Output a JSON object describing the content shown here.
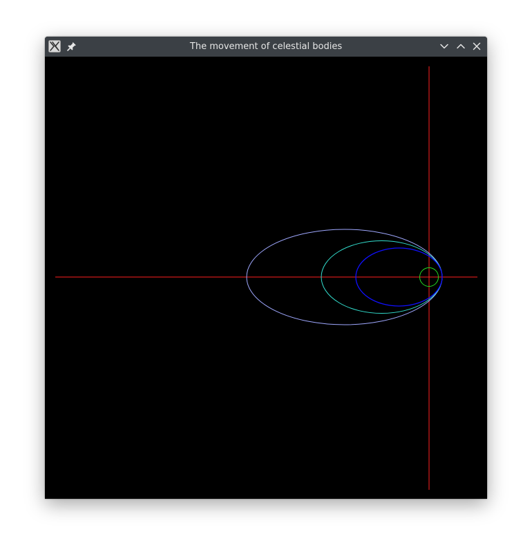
{
  "window": {
    "title": "The movement of celestial bodies"
  },
  "icons": {
    "app": "x11-app-icon",
    "pin": "pin-icon",
    "minimize": "chevron-down-icon",
    "maximize": "chevron-up-icon",
    "close": "close-icon"
  },
  "colors": {
    "titlebar": "#3b4045",
    "canvas_background": "#000000",
    "axes": "#ff2020",
    "orbit_outer": "#9fa8ff",
    "orbit_middle": "#33e0d0",
    "orbit_inner": "#1010ff",
    "orbit_small": "#22dd22"
  }
}
